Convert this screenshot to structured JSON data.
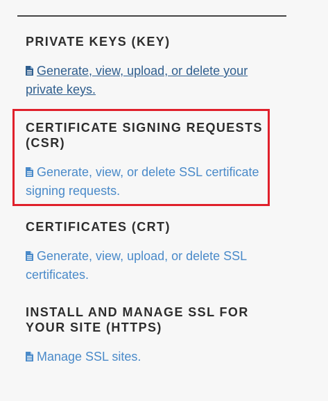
{
  "sections": [
    {
      "title": "PRIVATE KEYS (KEY)",
      "link_text": "Generate, view, upload, or delete your private keys.",
      "icon": "file-text-icon"
    },
    {
      "title": "CERTIFICATE SIGNING REQUESTS (CSR)",
      "link_text": "Generate, view, or delete SSL certificate signing requests.",
      "icon": "file-text-icon",
      "highlighted": true
    },
    {
      "title": "CERTIFICATES (CRT)",
      "link_text": "Generate, view, upload, or delete SSL certificates.",
      "icon": "file-text-icon"
    },
    {
      "title": "INSTALL AND MANAGE SSL FOR YOUR SITE (HTTPS)",
      "link_text": "Manage SSL sites.",
      "icon": "file-text-icon"
    }
  ],
  "colors": {
    "link": "#4a8ac9",
    "visited_link": "#2f5e8e",
    "heading": "#2d2d2d",
    "highlight_border": "#e0202b",
    "background": "#f7f7f7"
  }
}
